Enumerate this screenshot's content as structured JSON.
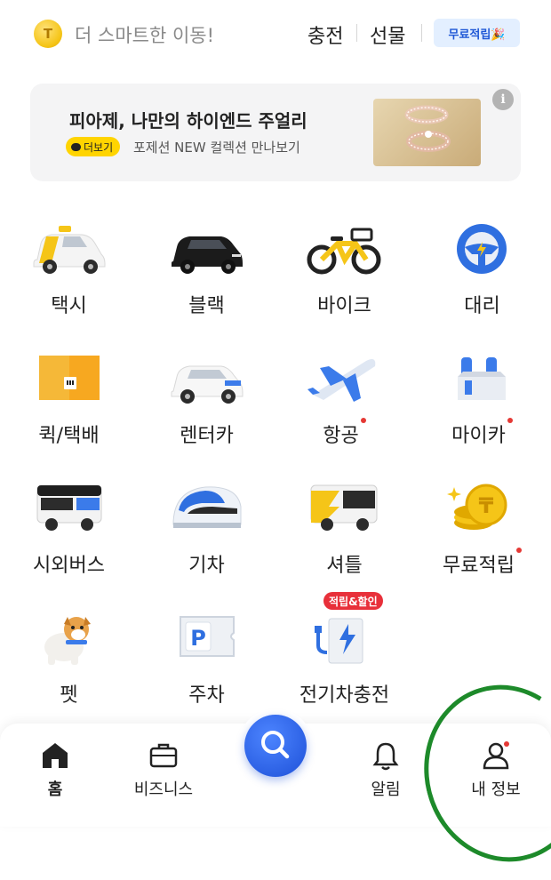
{
  "header": {
    "coin_glyph": "T",
    "tagline": "더 스마트한 이동!",
    "charge_label": "충전",
    "gift_label": "선물",
    "reward_label": "무료적립🎉"
  },
  "banner": {
    "title": "피아제, 나만의 하이엔드 주얼리",
    "tag_label": "더보기",
    "subtitle": "포제션 NEW 컬렉션 만나보기",
    "info_glyph": "i"
  },
  "services": [
    {
      "label": "택시",
      "icon": "taxi-icon",
      "dot": false
    },
    {
      "label": "블랙",
      "icon": "black-car-icon",
      "dot": false
    },
    {
      "label": "바이크",
      "icon": "bike-icon",
      "dot": false
    },
    {
      "label": "대리",
      "icon": "steering-wheel-icon",
      "dot": false
    },
    {
      "label": "퀵/택배",
      "icon": "parcel-box-icon",
      "dot": false
    },
    {
      "label": "렌터카",
      "icon": "rental-car-icon",
      "dot": false
    },
    {
      "label": "항공",
      "icon": "airplane-icon",
      "dot": true
    },
    {
      "label": "마이카",
      "icon": "toolbox-icon",
      "dot": true
    },
    {
      "label": "시외버스",
      "icon": "bus-icon",
      "dot": false
    },
    {
      "label": "기차",
      "icon": "train-icon",
      "dot": false
    },
    {
      "label": "셔틀",
      "icon": "shuttle-icon",
      "dot": false
    },
    {
      "label": "무료적립",
      "icon": "coin-stack-icon",
      "dot": true
    },
    {
      "label": "펫",
      "icon": "dog-icon",
      "dot": false
    },
    {
      "label": "주차",
      "icon": "parking-ticket-icon",
      "dot": false
    },
    {
      "label": "전기차충전",
      "icon": "ev-charger-icon",
      "dot": false,
      "badge": "적립&할인"
    }
  ],
  "nav": {
    "home": "홈",
    "business": "비즈니스",
    "alerts": "알림",
    "my_info": "내 정보"
  },
  "colors": {
    "accent_blue": "#1d50d8",
    "taxi_yellow": "#f5c518",
    "notification_red": "#e53935",
    "annotation_green": "#1d8a2a"
  }
}
